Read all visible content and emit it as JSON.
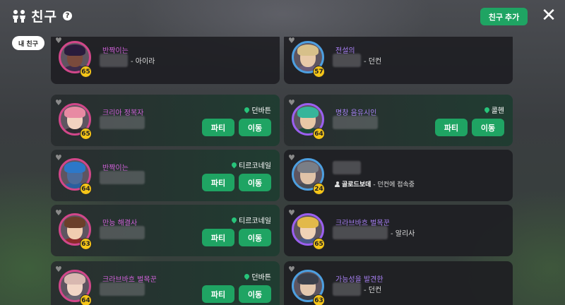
{
  "header": {
    "title": "친구",
    "help": "?",
    "add_friend": "친구 추가",
    "close": "✕",
    "filter": "내 친구"
  },
  "cards": [
    {
      "name": "반짝이는",
      "level": "65",
      "sub": "- 아이라",
      "location": "",
      "online": false,
      "ring": "pink",
      "hair": "#2a1c3c",
      "skin": "#7a4a3c",
      "body": "#3d2b4a",
      "col": 0,
      "row": 0
    },
    {
      "name": "전설의",
      "level": "57",
      "sub": "- 던컨",
      "location": "",
      "online": false,
      "ring": "blue",
      "hair": "#d7c08a",
      "skin": "#e8c9a8",
      "body": "#6a5c7a",
      "col": 1,
      "row": 0
    },
    {
      "name": "크리아 정복자",
      "level": "65",
      "sub": "",
      "location": "던바튼",
      "online": true,
      "ring": "pink",
      "hair": "#e88aa3",
      "skin": "#f2d2c0",
      "body": "#2e2a30",
      "col": 0,
      "row": 1
    },
    {
      "name": "명창 음유시인",
      "level": "64",
      "sub": "",
      "location": "콜헨",
      "online": true,
      "ring": "purple",
      "hair": "#36b59a",
      "skin": "#e8c7a6",
      "body": "#1e4a3a",
      "col": 1,
      "row": 1
    },
    {
      "name": "반짝이는",
      "level": "64",
      "sub": "",
      "location": "티르코네일",
      "online": true,
      "ring": "pink",
      "hair": "#2c78c9",
      "skin": "#4b6b9a",
      "body": "#2a5f9e",
      "col": 0,
      "row": 2
    },
    {
      "name": "",
      "level": "24",
      "sub": "",
      "location": "",
      "online": false,
      "ring": "blue",
      "hair": "#7a7e86",
      "skin": "#e0c3a8",
      "body": "#4a4e56",
      "col": 1,
      "row": 2,
      "status_name": "골로드보데",
      "status_text": "- 던컨에 접속중"
    },
    {
      "name": "만능 해결사",
      "level": "63",
      "sub": "",
      "location": "티르코네일",
      "online": true,
      "ring": "pink",
      "hair": "#6b3f2a",
      "skin": "#f0cdb0",
      "body": "#8a2a2a",
      "col": 0,
      "row": 3
    },
    {
      "name": "크라브바흐 벌목꾼",
      "level": "65",
      "sub": "- 알리사",
      "location": "",
      "online": false,
      "ring": "purple",
      "hair": "#e2b94a",
      "skin": "#f0d2b6",
      "body": "#4a5a8a",
      "col": 1,
      "row": 3
    },
    {
      "name": "크라브바흐 벌목꾼",
      "level": "64",
      "sub": "",
      "location": "던바튼",
      "online": true,
      "ring": "pink",
      "hair": "#d8b8b0",
      "skin": "#f2d6c6",
      "body": "#6a6470",
      "col": 0,
      "row": 4
    },
    {
      "name": "가능성을 발견한",
      "level": "63",
      "sub": "- 던컨",
      "location": "",
      "online": false,
      "ring": "blue",
      "hair": "#3a3f4a",
      "skin": "#e4c8ae",
      "body": "#3a3f4a",
      "col": 1,
      "row": 4
    }
  ],
  "buttons": {
    "party": "파티",
    "move": "이동"
  },
  "colors": {
    "accent": "#1fa463",
    "name_pink": "#d061d9",
    "name_purple": "#a880f5",
    "level_badge": "#f5c518"
  }
}
